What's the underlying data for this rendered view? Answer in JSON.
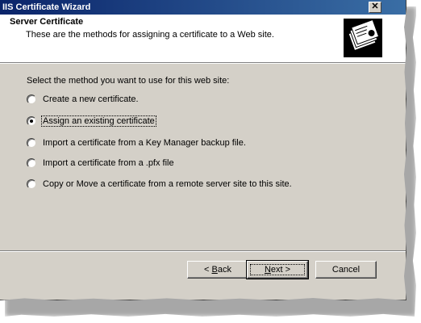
{
  "window": {
    "title": "IIS Certificate Wizard",
    "close_glyph": "✕"
  },
  "header": {
    "title": "Server Certificate",
    "subtitle": "These are the methods for assigning a certificate to a Web site.",
    "icon": "certificate-icon"
  },
  "main": {
    "prompt": "Select the method you want to use for this web site:",
    "options": [
      {
        "label": "Create a new certificate.",
        "checked": false
      },
      {
        "label": "Assign an existing certificate",
        "checked": true
      },
      {
        "label": "Import a certificate from a Key Manager backup file.",
        "checked": false
      },
      {
        "label": "Import a certificate from a .pfx file",
        "checked": false
      },
      {
        "label": "Copy or Move a certificate from a remote server site to this site.",
        "checked": false
      }
    ]
  },
  "buttons": {
    "back_prefix": "< ",
    "back_mnemonic": "B",
    "back_rest": "ack",
    "next_mnemonic": "N",
    "next_rest": "ext >",
    "cancel": "Cancel"
  }
}
